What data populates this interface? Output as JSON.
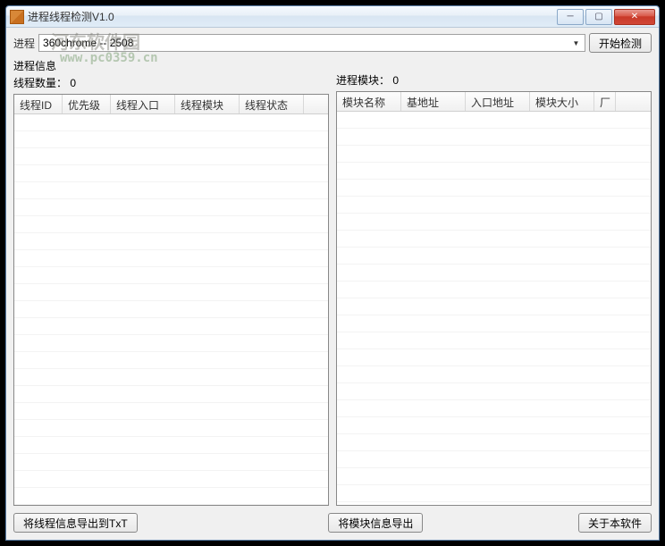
{
  "window": {
    "title": "进程线程检测V1.0"
  },
  "watermark": {
    "text": "河东软件园",
    "url": "www.pc0359.cn"
  },
  "toolbar": {
    "process_label": "进程",
    "process_selected": "360chrome -- 2508",
    "start_button": "开始检测"
  },
  "left_panel": {
    "title": "进程信息",
    "count_label": "线程数量：",
    "count_value": "0",
    "columns": [
      "线程ID",
      "优先级",
      "线程入口",
      "线程模块",
      "线程状态"
    ]
  },
  "right_panel": {
    "title_label": "进程模块：",
    "title_value": "0",
    "columns": [
      "模块名称",
      "基地址",
      "入口地址",
      "模块大小",
      "厂"
    ]
  },
  "buttons": {
    "export_thread": "将线程信息导出到TxT",
    "export_module": "将模块信息导出",
    "about": "关于本软件"
  }
}
